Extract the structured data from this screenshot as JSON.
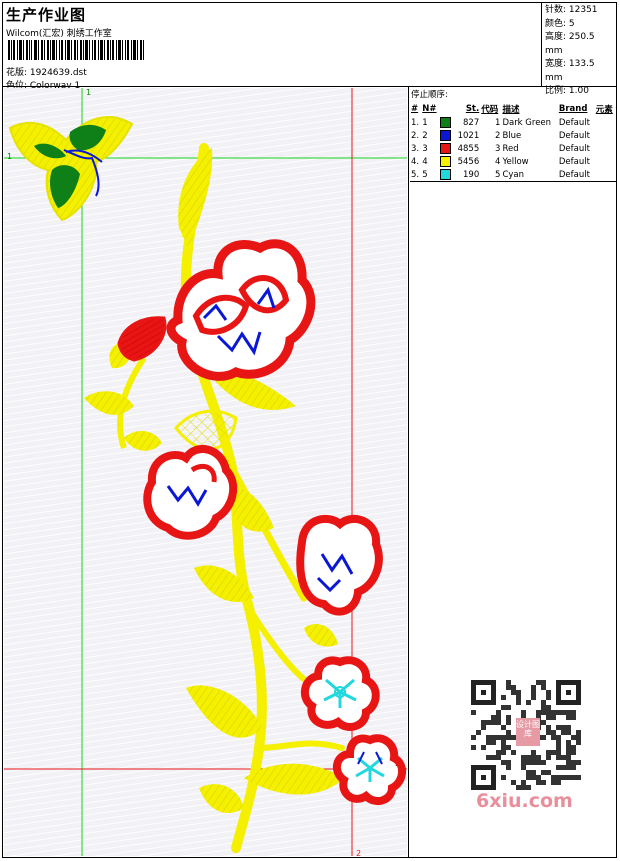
{
  "header": {
    "title": "生产作业图",
    "subtitle": "Wilcom(汇宏) 刺绣工作室",
    "design_label": "花版: 1924639.dst",
    "colorway_label": "色位: Colorway 1"
  },
  "stats": {
    "stitches": "针数: 12351",
    "colors": "颜色: 5",
    "height": "高度: 250.5 mm",
    "width": "宽度: 133.5 mm",
    "scale": "比例: 1.00"
  },
  "stop_sequence": {
    "title": "停止顺序:",
    "columns": [
      "#",
      "N#",
      "St.",
      "代码",
      "描述",
      "Brand",
      "元素"
    ],
    "rows": [
      {
        "idx": "1.",
        "n": "1",
        "color": "#0f7f17",
        "st": "827",
        "code": "1",
        "desc": "Dark Green",
        "brand": "Default"
      },
      {
        "idx": "2.",
        "n": "2",
        "color": "#0a18d6",
        "st": "1021",
        "code": "2",
        "desc": "Blue",
        "brand": "Default"
      },
      {
        "idx": "3.",
        "n": "3",
        "color": "#e81515",
        "st": "4855",
        "code": "3",
        "desc": "Red",
        "brand": "Default"
      },
      {
        "idx": "4.",
        "n": "4",
        "color": "#f4f000",
        "st": "5456",
        "code": "4",
        "desc": "Yellow",
        "brand": "Default"
      },
      {
        "idx": "5.",
        "n": "5",
        "color": "#22d8dc",
        "st": "190",
        "code": "5",
        "desc": "Cyan",
        "brand": "Default"
      }
    ]
  },
  "guides": {
    "left_top": "1",
    "left_side": "1",
    "right_bottom": "2",
    "bottom_right": "2"
  },
  "qr": {
    "stamp": "设计图库"
  },
  "watermark": "6xiu.com",
  "colors": {
    "green": "#0f7f17",
    "blue": "#0a18d6",
    "red": "#e81515",
    "yellow": "#f4f000",
    "cyan": "#22d8dc"
  }
}
